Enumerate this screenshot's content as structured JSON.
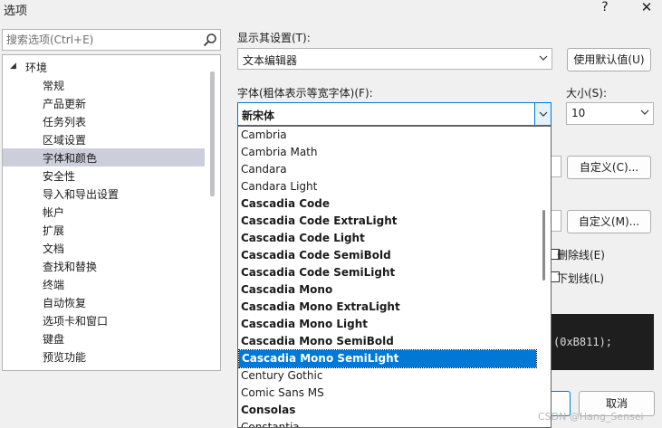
{
  "window": {
    "title": "选项",
    "help_glyph": "?",
    "close_glyph": "✕"
  },
  "search": {
    "placeholder": "搜索选项(Ctrl+E)",
    "icon": "search-icon"
  },
  "tree": {
    "root_label": "环境",
    "items": [
      "常规",
      "产品更新",
      "任务列表",
      "区域设置",
      "字体和颜色",
      "安全性",
      "导入和导出设置",
      "帐户",
      "扩展",
      "文档",
      "查找和替换",
      "终端",
      "自动恢复",
      "选项卡和窗口",
      "键盘",
      "预览功能"
    ],
    "selected_index": 4
  },
  "display_settings": {
    "label": "显示其设置(T):",
    "value": "文本编辑器",
    "use_default_button": "使用默认值(U)"
  },
  "font": {
    "label": "字体(粗体表示等宽字体)(F):",
    "value": "新宋体"
  },
  "size": {
    "label": "大小(S):",
    "value": "10"
  },
  "customize_buttons": [
    "自定义(C)...",
    "自定义(M)..."
  ],
  "checkboxes": {
    "strikethrough": "删除线(E)",
    "underline": "下划线(L)"
  },
  "preview": {
    "text": "(0xB811);"
  },
  "buttons": {
    "cancel": "取消"
  },
  "font_list": {
    "items": [
      {
        "name": "Cambria",
        "bold": false
      },
      {
        "name": "Cambria Math",
        "bold": false
      },
      {
        "name": "Candara",
        "bold": false
      },
      {
        "name": "Candara Light",
        "bold": false
      },
      {
        "name": "Cascadia Code",
        "bold": true
      },
      {
        "name": "Cascadia Code ExtraLight",
        "bold": true
      },
      {
        "name": "Cascadia Code Light",
        "bold": true
      },
      {
        "name": "Cascadia Code SemiBold",
        "bold": true
      },
      {
        "name": "Cascadia Code SemiLight",
        "bold": true
      },
      {
        "name": "Cascadia Mono",
        "bold": true
      },
      {
        "name": "Cascadia Mono ExtraLight",
        "bold": true
      },
      {
        "name": "Cascadia Mono Light",
        "bold": true
      },
      {
        "name": "Cascadia Mono SemiBold",
        "bold": true
      },
      {
        "name": "Cascadia Mono SemiLight",
        "bold": true
      },
      {
        "name": "Century Gothic",
        "bold": false
      },
      {
        "name": "Comic Sans MS",
        "bold": false
      },
      {
        "name": "Consolas",
        "bold": true
      },
      {
        "name": "Constantia",
        "bold": false
      }
    ],
    "selected_index": 13
  },
  "watermark": "CSDN @Hang_Sensei",
  "colors": {
    "accent": "#0078d7",
    "selected_tree": "#cccedb",
    "preview_bg": "#1e1e1e"
  }
}
